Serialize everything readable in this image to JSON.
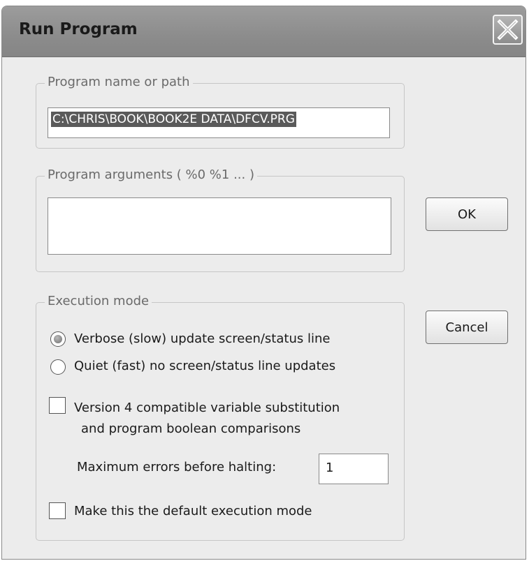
{
  "window": {
    "title": "Run Program",
    "close_icon": "close-x-icon"
  },
  "program_name_group": {
    "legend": "Program name or path",
    "value": "C:\\CHRIS\\BOOK\\BOOK2E DATA\\DFCV.PRG"
  },
  "program_args_group": {
    "legend": "Program arguments ( %0  %1 ... )",
    "value": ""
  },
  "buttons": {
    "ok": "OK",
    "cancel": "Cancel"
  },
  "execution_mode": {
    "legend": "Execution mode",
    "options": [
      {
        "label": "Verbose (slow) update screen/status line",
        "selected": true
      },
      {
        "label": "Quiet (fast) no screen/status line updates",
        "selected": false
      }
    ],
    "version4_line1": "Version 4 compatible variable substitution",
    "version4_line2": "and program boolean comparisons",
    "version4_checked": false,
    "max_errors_label": "Maximum errors before halting:",
    "max_errors_value": "1",
    "default_mode_label": "Make this the default execution mode",
    "default_mode_checked": false
  }
}
